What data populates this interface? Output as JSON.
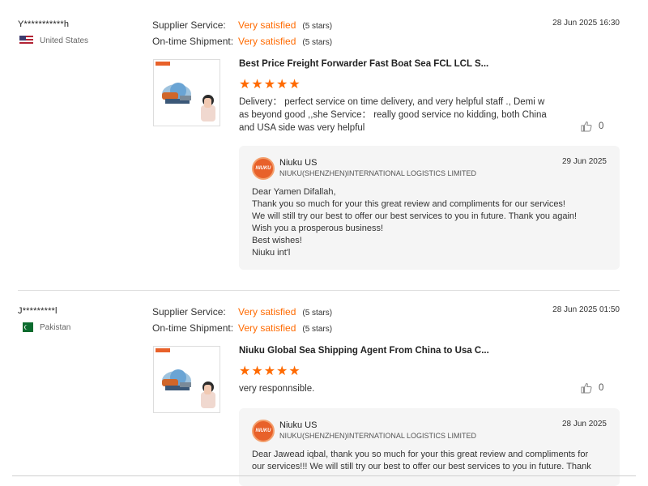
{
  "reviews": [
    {
      "buyer_name": "Y***********h",
      "country": "United States",
      "ratings": [
        {
          "label": "Supplier Service:",
          "value": "Very satisfied",
          "stars_text": "(5 stars)"
        },
        {
          "label": "On-time Shipment:",
          "value": "Very satisfied",
          "stars_text": "(5 stars)"
        }
      ],
      "date": "28 Jun 2025 16:30",
      "product_title": "Best Price Freight Forwarder Fast Boat Sea FCL LCL S...",
      "star_rating": 5,
      "text_lines": [
        "Delivery：  perfect service on time delivery, and very helpful staff ., Demi w",
        "as beyond good ,,she Service：  really good service no kidding,  both China",
        "and USA side was very helpful"
      ],
      "likes": "0",
      "reply": {
        "name": "Niuku US",
        "company": "NIUKU(SHENZHEN)INTERNATIONAL LOGISTICS LIMITED",
        "date": "29 Jun 2025",
        "lines": [
          "Dear Yamen Difallah,",
          "Thank you so much for your this great review and compliments for our services!",
          "We will still try our best to offer our best services to you in future. Thank you again!",
          "Wish you a prosperous business!",
          "Best wishes!",
          "Niuku int'l"
        ]
      }
    },
    {
      "buyer_name": "J*********l",
      "country": "Pakistan",
      "ratings": [
        {
          "label": "Supplier Service:",
          "value": "Very satisfied",
          "stars_text": "(5 stars)"
        },
        {
          "label": "On-time Shipment:",
          "value": "Very satisfied",
          "stars_text": "(5 stars)"
        }
      ],
      "date": "28 Jun 2025 01:50",
      "product_title": "Niuku Global Sea Shipping Agent From China to Usa C...",
      "star_rating": 5,
      "text_lines": [
        "very responnsible."
      ],
      "likes": "0",
      "reply": {
        "name": "Niuku US",
        "company": "NIUKU(SHENZHEN)INTERNATIONAL LOGISTICS LIMITED",
        "date": "28 Jun 2025",
        "lines": [
          "Dear Jawead iqbal, thank you so much for your this great review and compliments for",
          "our services!!! We will still try our best to offer our best services to you in future. Thank"
        ]
      }
    }
  ],
  "colors": {
    "accent": "#ff6a00",
    "brand": "#e8612a",
    "reply_bg": "#f5f5f5"
  },
  "icons": {
    "like": "thumbs-up-icon",
    "star": "star-icon",
    "logo": "niuku-logo-icon"
  },
  "logo_text": "NIUKU"
}
